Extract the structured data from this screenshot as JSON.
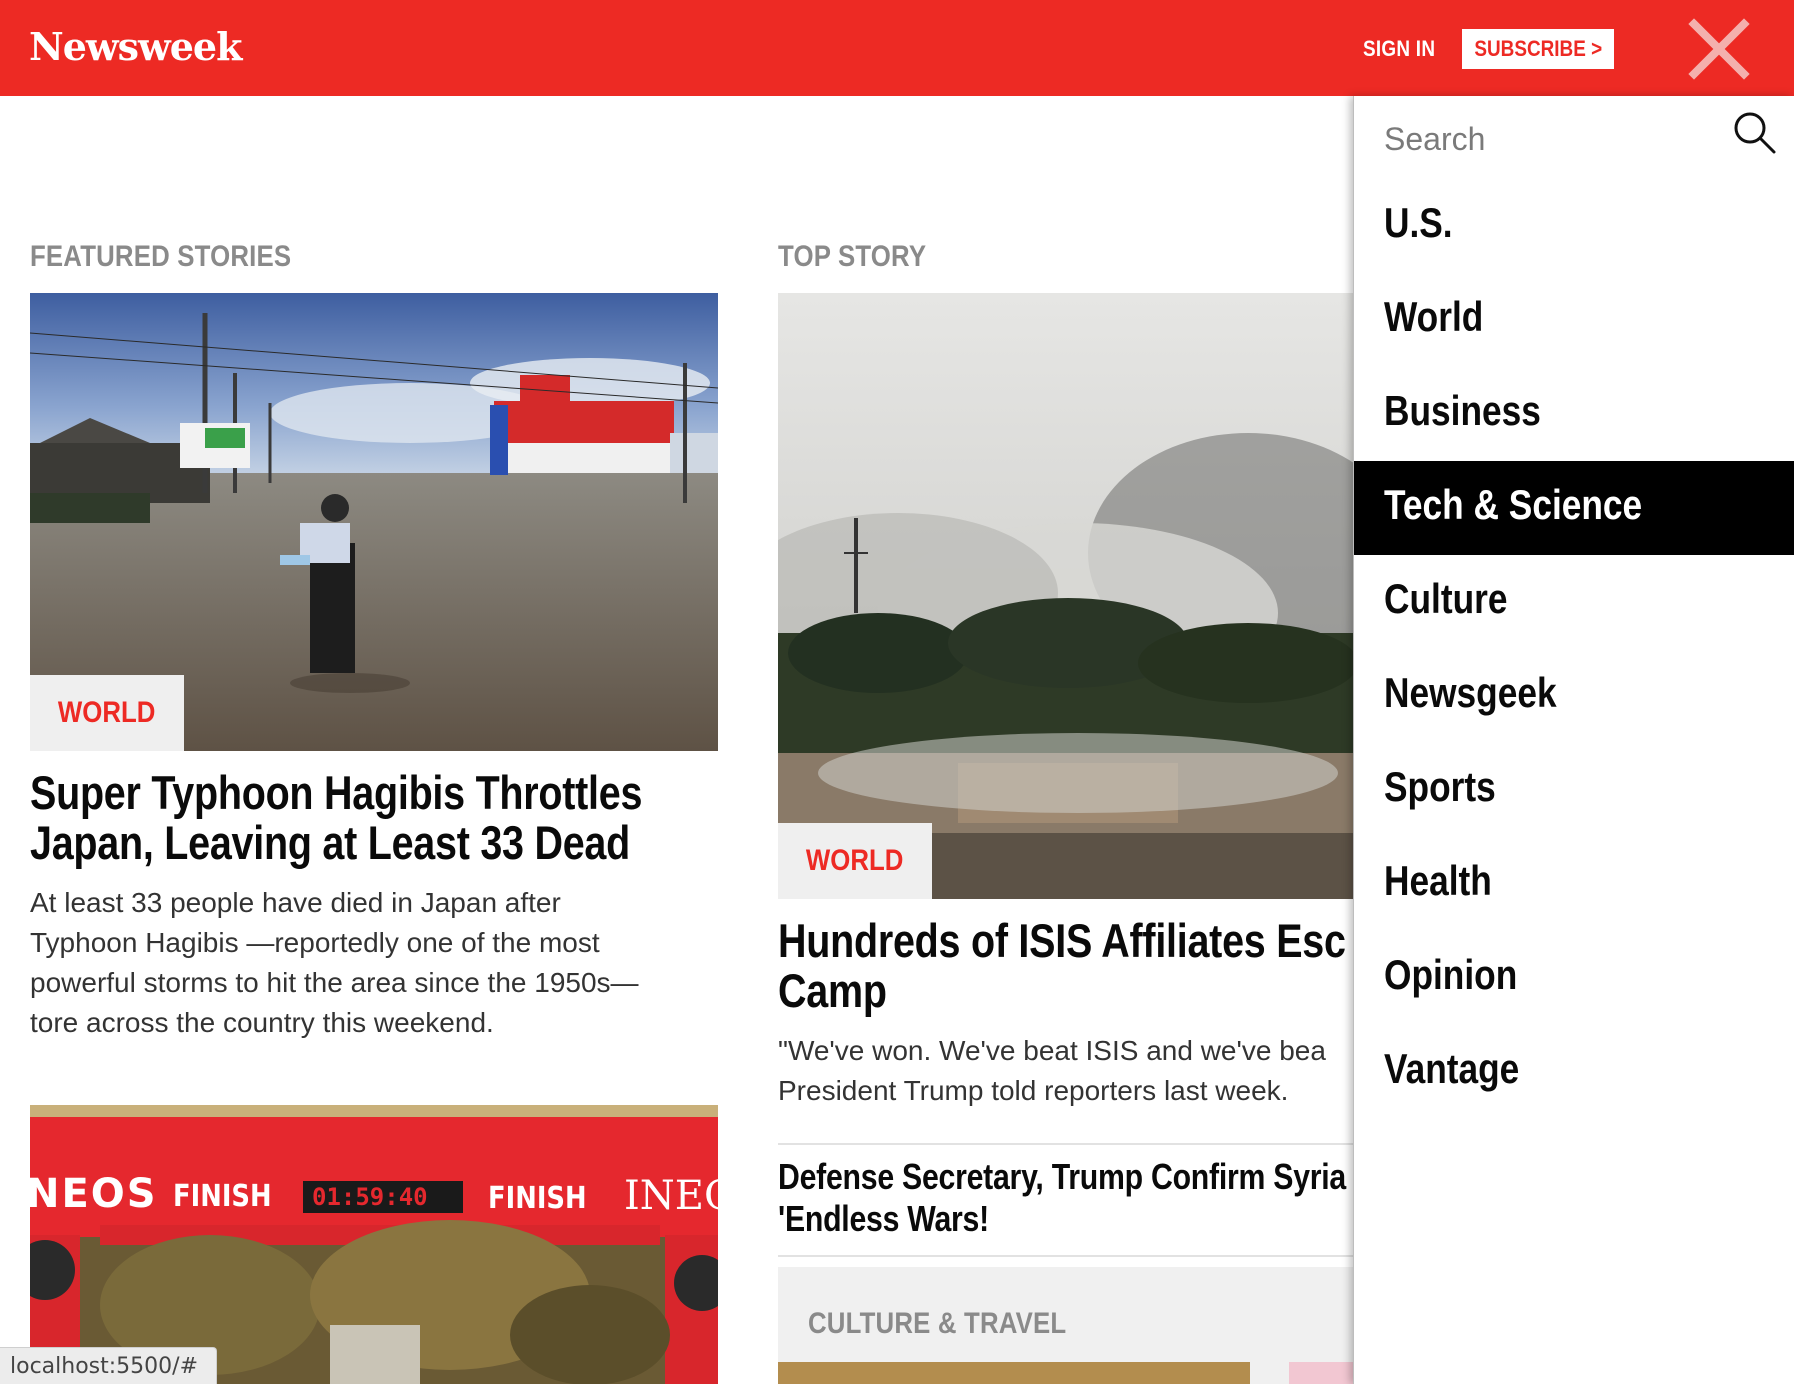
{
  "header": {
    "logo": "Newsweek",
    "signin_label": "SIGN IN",
    "subscribe_label": "SUBSCRIBE >",
    "brand_color": "#ed2a24"
  },
  "featured": {
    "section_label": "FEATURED STORIES",
    "story1": {
      "tag": "WORLD",
      "headline_line1": "Super Typhoon Hagibis Throttles",
      "headline_line2": "Japan, Leaving at Least 33 Dead",
      "dek_lines": [
        "At least 33 people have died in Japan after",
        "Typhoon Hagibis —reportedly one of the most",
        "powerful storms to hit the area since the 1950s—",
        "tore across the country this weekend."
      ]
    },
    "story2": {
      "banner_words": [
        "NEOS",
        "FINISH",
        "01:59:40",
        "FINISH",
        "INEO"
      ]
    }
  },
  "top_story": {
    "section_label": "TOP STORY",
    "tag": "WORLD",
    "headline_line1": "Hundreds of ISIS Affiliates Esc",
    "headline_line2": "Camp",
    "dek_lines": [
      "\"We've won. We've beat ISIS and we've bea",
      "President Trump told reporters last week."
    ],
    "related": {
      "line1": "Defense Secretary, Trump Confirm Syria",
      "line2": "'Endless Wars!"
    },
    "culture_label": "CULTURE & TRAVEL"
  },
  "drawer": {
    "search_placeholder": "Search",
    "items": [
      {
        "label": "U.S."
      },
      {
        "label": "World"
      },
      {
        "label": "Business"
      },
      {
        "label": "Tech & Science"
      },
      {
        "label": "Culture"
      },
      {
        "label": "Newsgeek"
      },
      {
        "label": "Sports"
      },
      {
        "label": "Health"
      },
      {
        "label": "Opinion"
      },
      {
        "label": "Vantage"
      }
    ],
    "active_item": "Tech & Science"
  },
  "status_bar": {
    "url": "localhost:5500/#"
  }
}
